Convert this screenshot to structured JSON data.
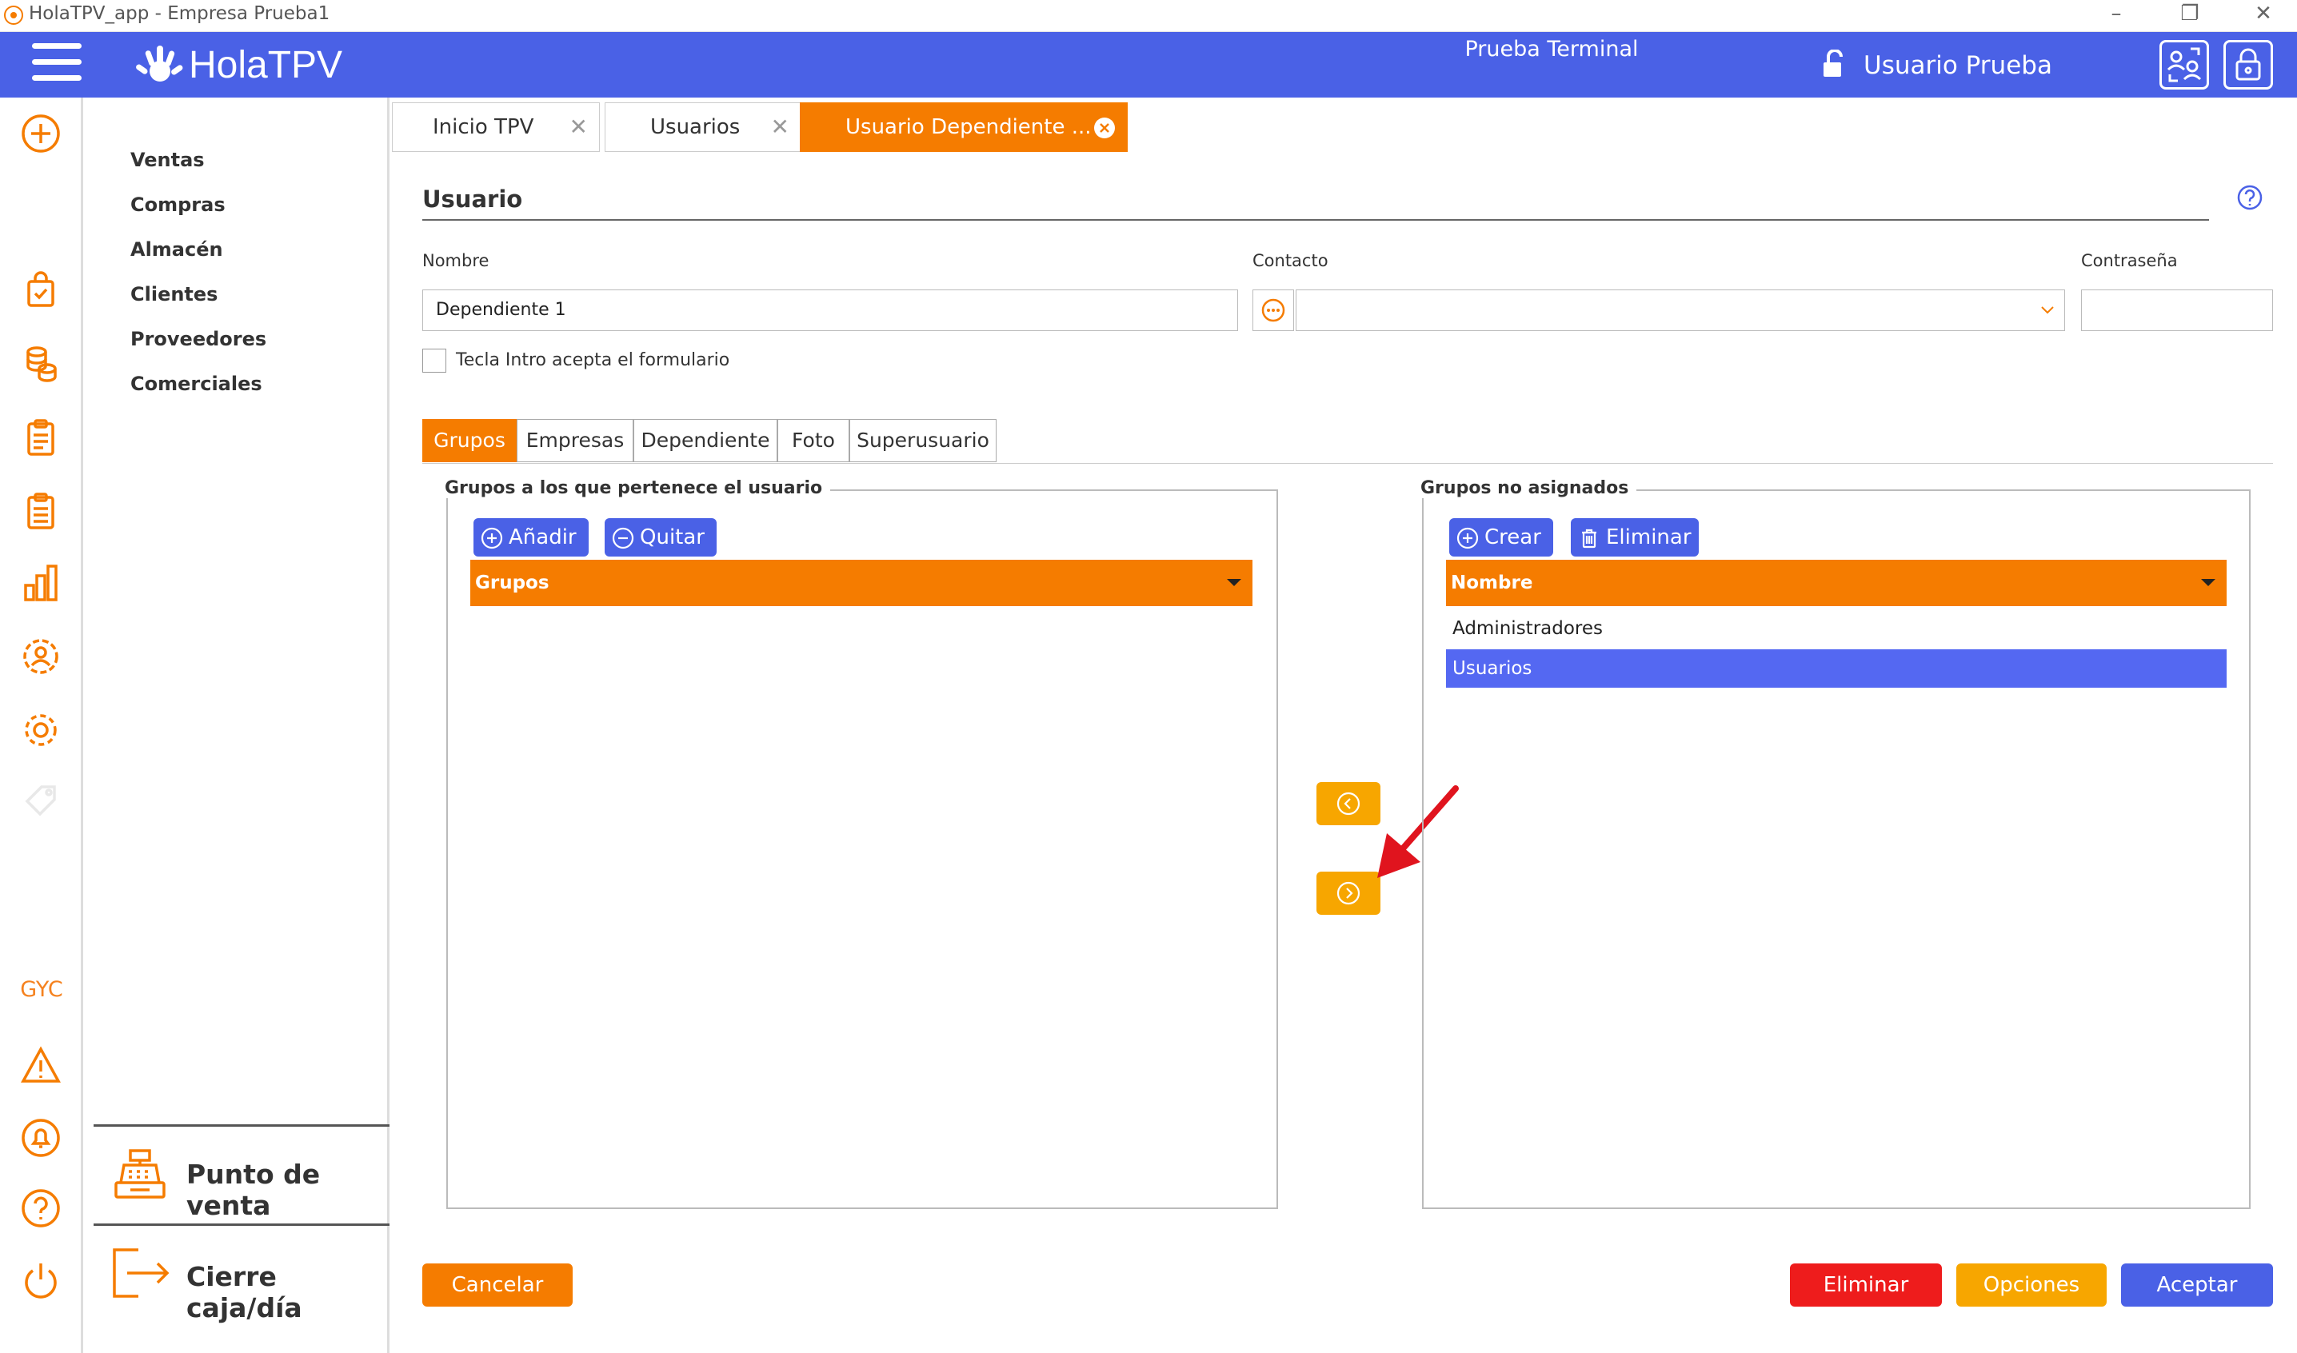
{
  "window": {
    "title": "HolaTPV_app - Empresa Prueba1"
  },
  "header": {
    "brand": "HolaTPV",
    "terminal": "Prueba Terminal",
    "user": "Usuario Prueba"
  },
  "iconbar": {
    "gyc": "GYC"
  },
  "menu": {
    "items": [
      "Ventas",
      "Compras",
      "Almacén",
      "Clientes",
      "Proveedores",
      "Comerciales"
    ],
    "pos": "Punto de venta",
    "close": "Cierre caja/día"
  },
  "tabs": [
    {
      "label": "Inicio TPV"
    },
    {
      "label": "Usuarios"
    },
    {
      "label": "Usuario Dependiente ..."
    }
  ],
  "form": {
    "section_title": "Usuario",
    "nombre_label": "Nombre",
    "nombre_value": "Dependiente 1",
    "contacto_label": "Contacto",
    "contacto_value": "",
    "contrasena_label": "Contraseña",
    "contrasena_value": "",
    "enter_checkbox": {
      "label": "Tecla Intro acepta el formulario",
      "checked": false
    }
  },
  "subtabs": [
    "Grupos",
    "Empresas",
    "Dependiente",
    "Foto",
    "Superusuario"
  ],
  "left_group": {
    "legend": "Grupos a los que pertenece el usuario",
    "add": "Añadir",
    "remove": "Quitar",
    "header": "Grupos",
    "rows": []
  },
  "right_group": {
    "legend": "Grupos no asignados",
    "create": "Crear",
    "delete": "Eliminar",
    "header": "Nombre",
    "rows": [
      {
        "name": "Administradores",
        "selected": false
      },
      {
        "name": "Usuarios",
        "selected": true
      }
    ]
  },
  "footer": {
    "cancel": "Cancelar",
    "delete": "Eliminar",
    "options": "Opciones",
    "accept": "Aceptar"
  },
  "colors": {
    "brand_blue": "#4a61e6",
    "orange": "#f57c00",
    "yellow": "#f7a600",
    "red": "#ee1c1c",
    "selection": "#5468f2",
    "annotation_arrow": "#e0141e"
  }
}
